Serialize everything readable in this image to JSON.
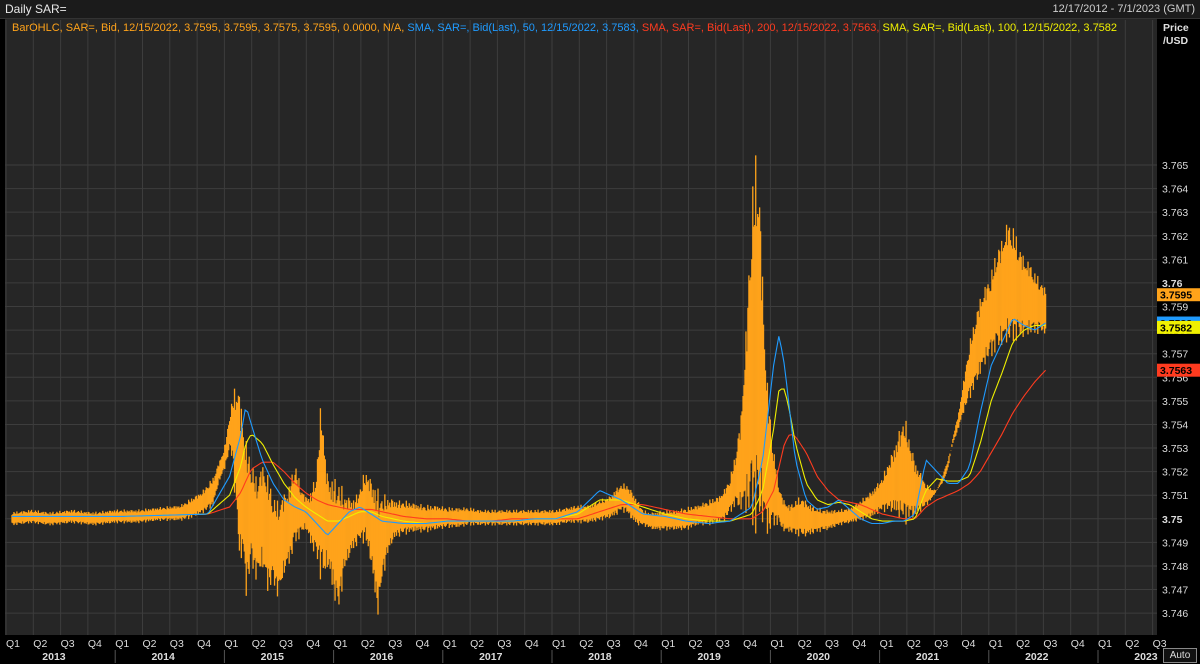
{
  "header": {
    "title": "Daily SAR=",
    "date_range": "12/17/2012 - 7/1/2023 (GMT)"
  },
  "legend": {
    "ohlc": {
      "text": "BarOHLC, SAR=, Bid,  12/15/2022, 3.7595, 3.7595, 3.7575, 3.7595, 0.0000, N/A,",
      "color": "#ffa31a"
    },
    "sma50": {
      "text": "SMA, SAR=, Bid(Last),  50,  12/15/2022, 3.7583,",
      "color": "#1f9bff"
    },
    "sma200": {
      "text": "SMA, SAR=, Bid(Last),  200,  12/15/2022, 3.7563,",
      "color": "#ff3b1f"
    },
    "sma100": {
      "text": "SMA, SAR=, Bid(Last),  100,  12/15/2022, 3.7582",
      "color": "#f0f000"
    }
  },
  "axis": {
    "y_label_line1": "Price",
    "y_label_line2": "/USD",
    "auto_label": "Auto"
  },
  "colors": {
    "background": "#262626",
    "grid": "#3d3d3d",
    "bars": "#ffa31a",
    "sma50": "#1f9bff",
    "sma100": "#f0f000",
    "sma200": "#ff3b1f"
  },
  "chart_data": {
    "type": "bar",
    "ylim": [
      3.7452,
      3.7703
    ],
    "yticks": [
      "3.746",
      "3.747",
      "3.748",
      "3.749",
      "3.75",
      "3.751",
      "3.752",
      "3.753",
      "3.754",
      "3.755",
      "3.756",
      "3.757",
      "3.758",
      "3.759",
      "3.76",
      "3.761",
      "3.762",
      "3.763",
      "3.764",
      "3.765"
    ],
    "grid": true,
    "x_quarter_labels": [
      "Q1",
      "Q2",
      "Q3",
      "Q4",
      "Q1",
      "Q2",
      "Q3",
      "Q4",
      "Q1",
      "Q2",
      "Q3",
      "Q4",
      "Q1",
      "Q2",
      "Q3",
      "Q4",
      "Q1",
      "Q2",
      "Q3",
      "Q4",
      "Q1",
      "Q2",
      "Q3",
      "Q4",
      "Q1",
      "Q2",
      "Q3",
      "Q4",
      "Q1",
      "Q2",
      "Q3",
      "Q4",
      "Q1",
      "Q2",
      "Q3",
      "Q4",
      "Q1",
      "Q2",
      "Q3",
      "Q4",
      "Q1",
      "Q2",
      "Q3"
    ],
    "x_year_labels": [
      "2013",
      "2014",
      "2015",
      "2016",
      "2017",
      "2018",
      "2019",
      "2020",
      "2021",
      "2022",
      "2023"
    ],
    "price_labels": [
      {
        "value": 3.7595,
        "text": "3.7595",
        "color": "#ffa31a"
      },
      {
        "value": 3.7583,
        "text": "3.7583",
        "color": "#1f9bff"
      },
      {
        "value": 3.7582,
        "text": "3.7582",
        "color": "#f0f000"
      },
      {
        "value": 3.7563,
        "text": "3.7563",
        "color": "#ff3b1f"
      }
    ],
    "ohlc_range_t": [
      0.0,
      0.018,
      0.035,
      0.055,
      0.075,
      0.095,
      0.115,
      0.135,
      0.155,
      0.165,
      0.175,
      0.185,
      0.19,
      0.195,
      0.198,
      0.2,
      0.203,
      0.205,
      0.207,
      0.21,
      0.212,
      0.215,
      0.22,
      0.225,
      0.23,
      0.235,
      0.24,
      0.245,
      0.25,
      0.255,
      0.26,
      0.265,
      0.27,
      0.275,
      0.28,
      0.283,
      0.285,
      0.287,
      0.29,
      0.295,
      0.3,
      0.305,
      0.31,
      0.315,
      0.32,
      0.325,
      0.33,
      0.335,
      0.337,
      0.34,
      0.345,
      0.35,
      0.355,
      0.36,
      0.37,
      0.38,
      0.39,
      0.4,
      0.41,
      0.42,
      0.43,
      0.44,
      0.45,
      0.46,
      0.47,
      0.48,
      0.49,
      0.5,
      0.51,
      0.52,
      0.53,
      0.54,
      0.55,
      0.555,
      0.56,
      0.565,
      0.57,
      0.575,
      0.58,
      0.585,
      0.59,
      0.6,
      0.61,
      0.62,
      0.63,
      0.64,
      0.65,
      0.655,
      0.66,
      0.665,
      0.67,
      0.675,
      0.68,
      0.685,
      0.688,
      0.69,
      0.693,
      0.695,
      0.698,
      0.7,
      0.703,
      0.705,
      0.708,
      0.71,
      0.715,
      0.72,
      0.725,
      0.73,
      0.735,
      0.74,
      0.75,
      0.76,
      0.77,
      0.78,
      0.79,
      0.8,
      0.81,
      0.82,
      0.83,
      0.84,
      0.845,
      0.85,
      0.855,
      0.86,
      0.865,
      0.87,
      0.875,
      0.88,
      0.885,
      0.89,
      0.895,
      0.9,
      0.905,
      0.91,
      0.915,
      0.92,
      0.925,
      0.93,
      0.935,
      0.94,
      0.945,
      0.95
    ],
    "ohlc_low": [
      3.7497,
      3.7498,
      3.7497,
      3.7498,
      3.7497,
      3.7498,
      3.7498,
      3.7499,
      3.7499,
      3.75,
      3.7502,
      3.7505,
      3.7515,
      3.752,
      3.7525,
      3.7528,
      3.7525,
      3.7505,
      3.7495,
      3.7475,
      3.7485,
      3.7465,
      3.748,
      3.7472,
      3.7478,
      3.7468,
      3.7472,
      3.7465,
      3.7475,
      3.748,
      3.7488,
      3.7492,
      3.7495,
      3.7488,
      3.7482,
      3.7475,
      3.747,
      3.7472,
      3.7478,
      3.7468,
      3.7458,
      3.7475,
      3.7483,
      3.7487,
      3.749,
      3.7489,
      3.748,
      3.746,
      3.7458,
      3.7472,
      3.7483,
      3.749,
      3.7492,
      3.7493,
      3.7494,
      3.7494,
      3.7495,
      3.7496,
      3.7496,
      3.7497,
      3.7497,
      3.7497,
      3.7497,
      3.7497,
      3.7497,
      3.7497,
      3.7497,
      3.7497,
      3.7498,
      3.7498,
      3.7498,
      3.7499,
      3.75,
      3.7501,
      3.7503,
      3.7502,
      3.7499,
      3.7497,
      3.7497,
      3.7496,
      3.7495,
      3.7495,
      3.7495,
      3.7495,
      3.7497,
      3.7497,
      3.7498,
      3.7499,
      3.7502,
      3.7505,
      3.7502,
      3.75,
      3.7495,
      3.7488,
      3.7493,
      3.7494,
      3.7492,
      3.7491,
      3.7494,
      3.7496,
      3.7497,
      3.7497,
      3.7495,
      3.7494,
      3.7494,
      3.7493,
      3.7492,
      3.7492,
      3.7493,
      3.7494,
      3.7495,
      3.7497,
      3.7498,
      3.7499,
      3.75,
      3.7503,
      3.7502,
      3.7497,
      3.75,
      3.7505,
      3.7508,
      3.7512,
      3.7518,
      3.7525,
      3.7532,
      3.7538,
      3.7545,
      3.755,
      3.7555,
      3.756,
      3.7565,
      3.7568,
      3.757,
      3.7572,
      3.7573,
      3.7574,
      3.7575,
      3.7576,
      3.7577,
      3.7578,
      3.7578,
      3.7578
    ],
    "ohlc_high": [
      3.7503,
      3.7504,
      3.7503,
      3.7504,
      3.7503,
      3.7504,
      3.7504,
      3.7505,
      3.7506,
      3.7509,
      3.7512,
      3.7518,
      3.7524,
      3.753,
      3.7538,
      3.7545,
      3.7552,
      3.7558,
      3.756,
      3.7555,
      3.7545,
      3.7535,
      3.7525,
      3.7518,
      3.7525,
      3.752,
      3.751,
      3.7508,
      3.7512,
      3.7515,
      3.7525,
      3.7515,
      3.751,
      3.7512,
      3.7522,
      3.7545,
      3.7555,
      3.7535,
      3.752,
      3.7518,
      3.7518,
      3.7512,
      3.751,
      3.7509,
      3.7514,
      3.7522,
      3.7518,
      3.7515,
      3.7513,
      3.7511,
      3.751,
      3.7509,
      3.7508,
      3.7508,
      3.7507,
      3.7506,
      3.7506,
      3.7505,
      3.7505,
      3.7505,
      3.7504,
      3.7504,
      3.7504,
      3.7504,
      3.7504,
      3.7504,
      3.7504,
      3.7504,
      3.7505,
      3.7506,
      3.7506,
      3.7508,
      3.751,
      3.7513,
      3.7515,
      3.7515,
      3.7512,
      3.7508,
      3.7504,
      3.7503,
      3.7503,
      3.7504,
      3.7504,
      3.7505,
      3.7506,
      3.7508,
      3.751,
      3.7513,
      3.7518,
      3.7528,
      3.7545,
      3.7585,
      3.764,
      3.7665,
      3.7635,
      3.7605,
      3.757,
      3.7555,
      3.754,
      3.753,
      3.7522,
      3.7515,
      3.751,
      3.7508,
      3.7506,
      3.7508,
      3.751,
      3.7508,
      3.7506,
      3.7505,
      3.7504,
      3.7504,
      3.7505,
      3.7508,
      3.7512,
      3.7518,
      3.753,
      3.7545,
      3.7525,
      3.7515,
      3.7513,
      3.7512,
      3.7515,
      3.752,
      3.7535,
      3.7545,
      3.756,
      3.7575,
      3.7585,
      3.7595,
      3.76,
      3.7605,
      3.7615,
      3.762,
      3.7628,
      3.7625,
      3.7618,
      3.7612,
      3.761,
      3.7605,
      3.7602,
      3.7598,
      3.7596
    ],
    "sma_t": [
      0.0,
      0.1,
      0.18,
      0.2,
      0.21,
      0.215,
      0.22,
      0.23,
      0.24,
      0.25,
      0.26,
      0.27,
      0.28,
      0.29,
      0.3,
      0.31,
      0.32,
      0.33,
      0.34,
      0.36,
      0.38,
      0.4,
      0.42,
      0.44,
      0.46,
      0.48,
      0.5,
      0.52,
      0.54,
      0.56,
      0.58,
      0.6,
      0.62,
      0.64,
      0.66,
      0.68,
      0.69,
      0.7,
      0.705,
      0.71,
      0.715,
      0.72,
      0.73,
      0.74,
      0.75,
      0.76,
      0.77,
      0.78,
      0.79,
      0.8,
      0.81,
      0.82,
      0.83,
      0.84,
      0.85,
      0.86,
      0.87,
      0.88,
      0.89,
      0.9,
      0.91,
      0.92,
      0.93,
      0.94,
      0.95
    ],
    "sma50": [
      3.7501,
      3.7501,
      3.7502,
      3.7518,
      3.7535,
      3.7548,
      3.754,
      3.7525,
      3.7515,
      3.7508,
      3.7505,
      3.7503,
      3.7498,
      3.7493,
      3.7498,
      3.7503,
      3.7505,
      3.7502,
      3.7499,
      3.7498,
      3.7498,
      3.7499,
      3.7499,
      3.7499,
      3.7499,
      3.75,
      3.75,
      3.7503,
      3.7512,
      3.7508,
      3.7502,
      3.7501,
      3.7499,
      3.7498,
      3.7499,
      3.7505,
      3.7525,
      3.7565,
      3.7578,
      3.7565,
      3.7545,
      3.7525,
      3.7508,
      3.7504,
      3.7505,
      3.7508,
      3.7504,
      3.75,
      3.7498,
      3.7498,
      3.7499,
      3.7499,
      3.7502,
      3.7525,
      3.752,
      3.7515,
      3.7515,
      3.7522,
      3.7545,
      3.7565,
      3.7575,
      3.7585,
      3.7582,
      3.758,
      3.7583
    ],
    "sma100": [
      3.7501,
      3.7501,
      3.7502,
      3.751,
      3.7522,
      3.7532,
      3.7536,
      3.7532,
      3.7523,
      3.7515,
      3.7509,
      3.7505,
      3.7502,
      3.7499,
      3.7499,
      3.7501,
      3.7503,
      3.7503,
      3.7501,
      3.7499,
      3.7498,
      3.7499,
      3.7499,
      3.7499,
      3.7499,
      3.75,
      3.75,
      3.7502,
      3.7508,
      3.7508,
      3.7505,
      3.7502,
      3.75,
      3.7499,
      3.7499,
      3.7502,
      3.7512,
      3.7538,
      3.7555,
      3.7555,
      3.7545,
      3.7532,
      3.7515,
      3.7508,
      3.7506,
      3.7507,
      3.7506,
      3.7503,
      3.75,
      3.7499,
      3.7499,
      3.7499,
      3.75,
      3.7512,
      3.7517,
      3.7516,
      3.7516,
      3.7518,
      3.7532,
      3.755,
      3.7562,
      3.7575,
      3.758,
      3.7582,
      3.7582
    ],
    "sma200": [
      3.7501,
      3.7501,
      3.7502,
      3.7505,
      3.7511,
      3.7516,
      3.7521,
      3.7524,
      3.7524,
      3.752,
      3.7515,
      3.7511,
      3.7508,
      3.7506,
      3.7505,
      3.7504,
      3.7504,
      3.7504,
      3.7503,
      3.7501,
      3.75,
      3.75,
      3.7499,
      3.7499,
      3.75,
      3.75,
      3.75,
      3.75,
      3.7503,
      3.7506,
      3.7506,
      3.7504,
      3.7502,
      3.7501,
      3.75,
      3.75,
      3.7503,
      3.7512,
      3.7522,
      3.7532,
      3.7536,
      3.7535,
      3.7528,
      3.7518,
      3.7512,
      3.7508,
      3.7507,
      3.7506,
      3.7504,
      3.7502,
      3.7501,
      3.75,
      3.75,
      3.7505,
      3.7508,
      3.751,
      3.7512,
      3.7515,
      3.752,
      3.7528,
      3.7536,
      3.7545,
      3.7552,
      3.7558,
      3.7563
    ]
  }
}
